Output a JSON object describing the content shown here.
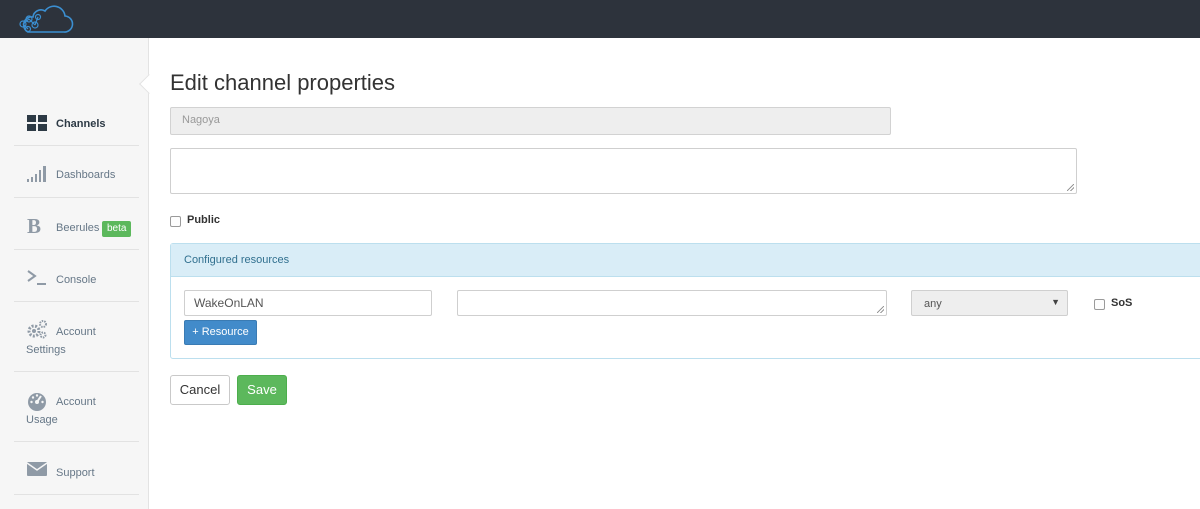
{
  "header": {
    "logo_icon": "cloud-network-logo-icon"
  },
  "sidebar": {
    "items": [
      {
        "label": "Channels",
        "icon": "grid-icon"
      },
      {
        "label": "Dashboards",
        "icon": "signal-bars-icon"
      },
      {
        "label": "Beerules",
        "icon": "letter-b-icon",
        "badge": "beta"
      },
      {
        "label": "Console",
        "icon": "terminal-prompt-icon"
      },
      {
        "label_line1": "Account",
        "label_line2": "Settings",
        "icon": "gears-icon"
      },
      {
        "label_line1": "Account",
        "label_line2": "Usage",
        "icon": "gauge-icon"
      },
      {
        "label": "Support",
        "icon": "envelope-icon"
      }
    ]
  },
  "main": {
    "title": "Edit channel properties",
    "name_value": "Nagoya",
    "description_value": "",
    "public_label": "Public",
    "public_checked": false,
    "resources": {
      "title": "Configured resources",
      "rows": [
        {
          "name": "WakeOnLAN",
          "description": "",
          "type": "any",
          "sos_label": "SoS",
          "sos_checked": false
        }
      ],
      "add_label": "+ Resource"
    },
    "cancel_label": "Cancel",
    "save_label": "Save"
  },
  "colors": {
    "topbar": "#2d333c",
    "primary": "#428bca",
    "success": "#5cb85c",
    "panel_header": "#d9edf7"
  }
}
